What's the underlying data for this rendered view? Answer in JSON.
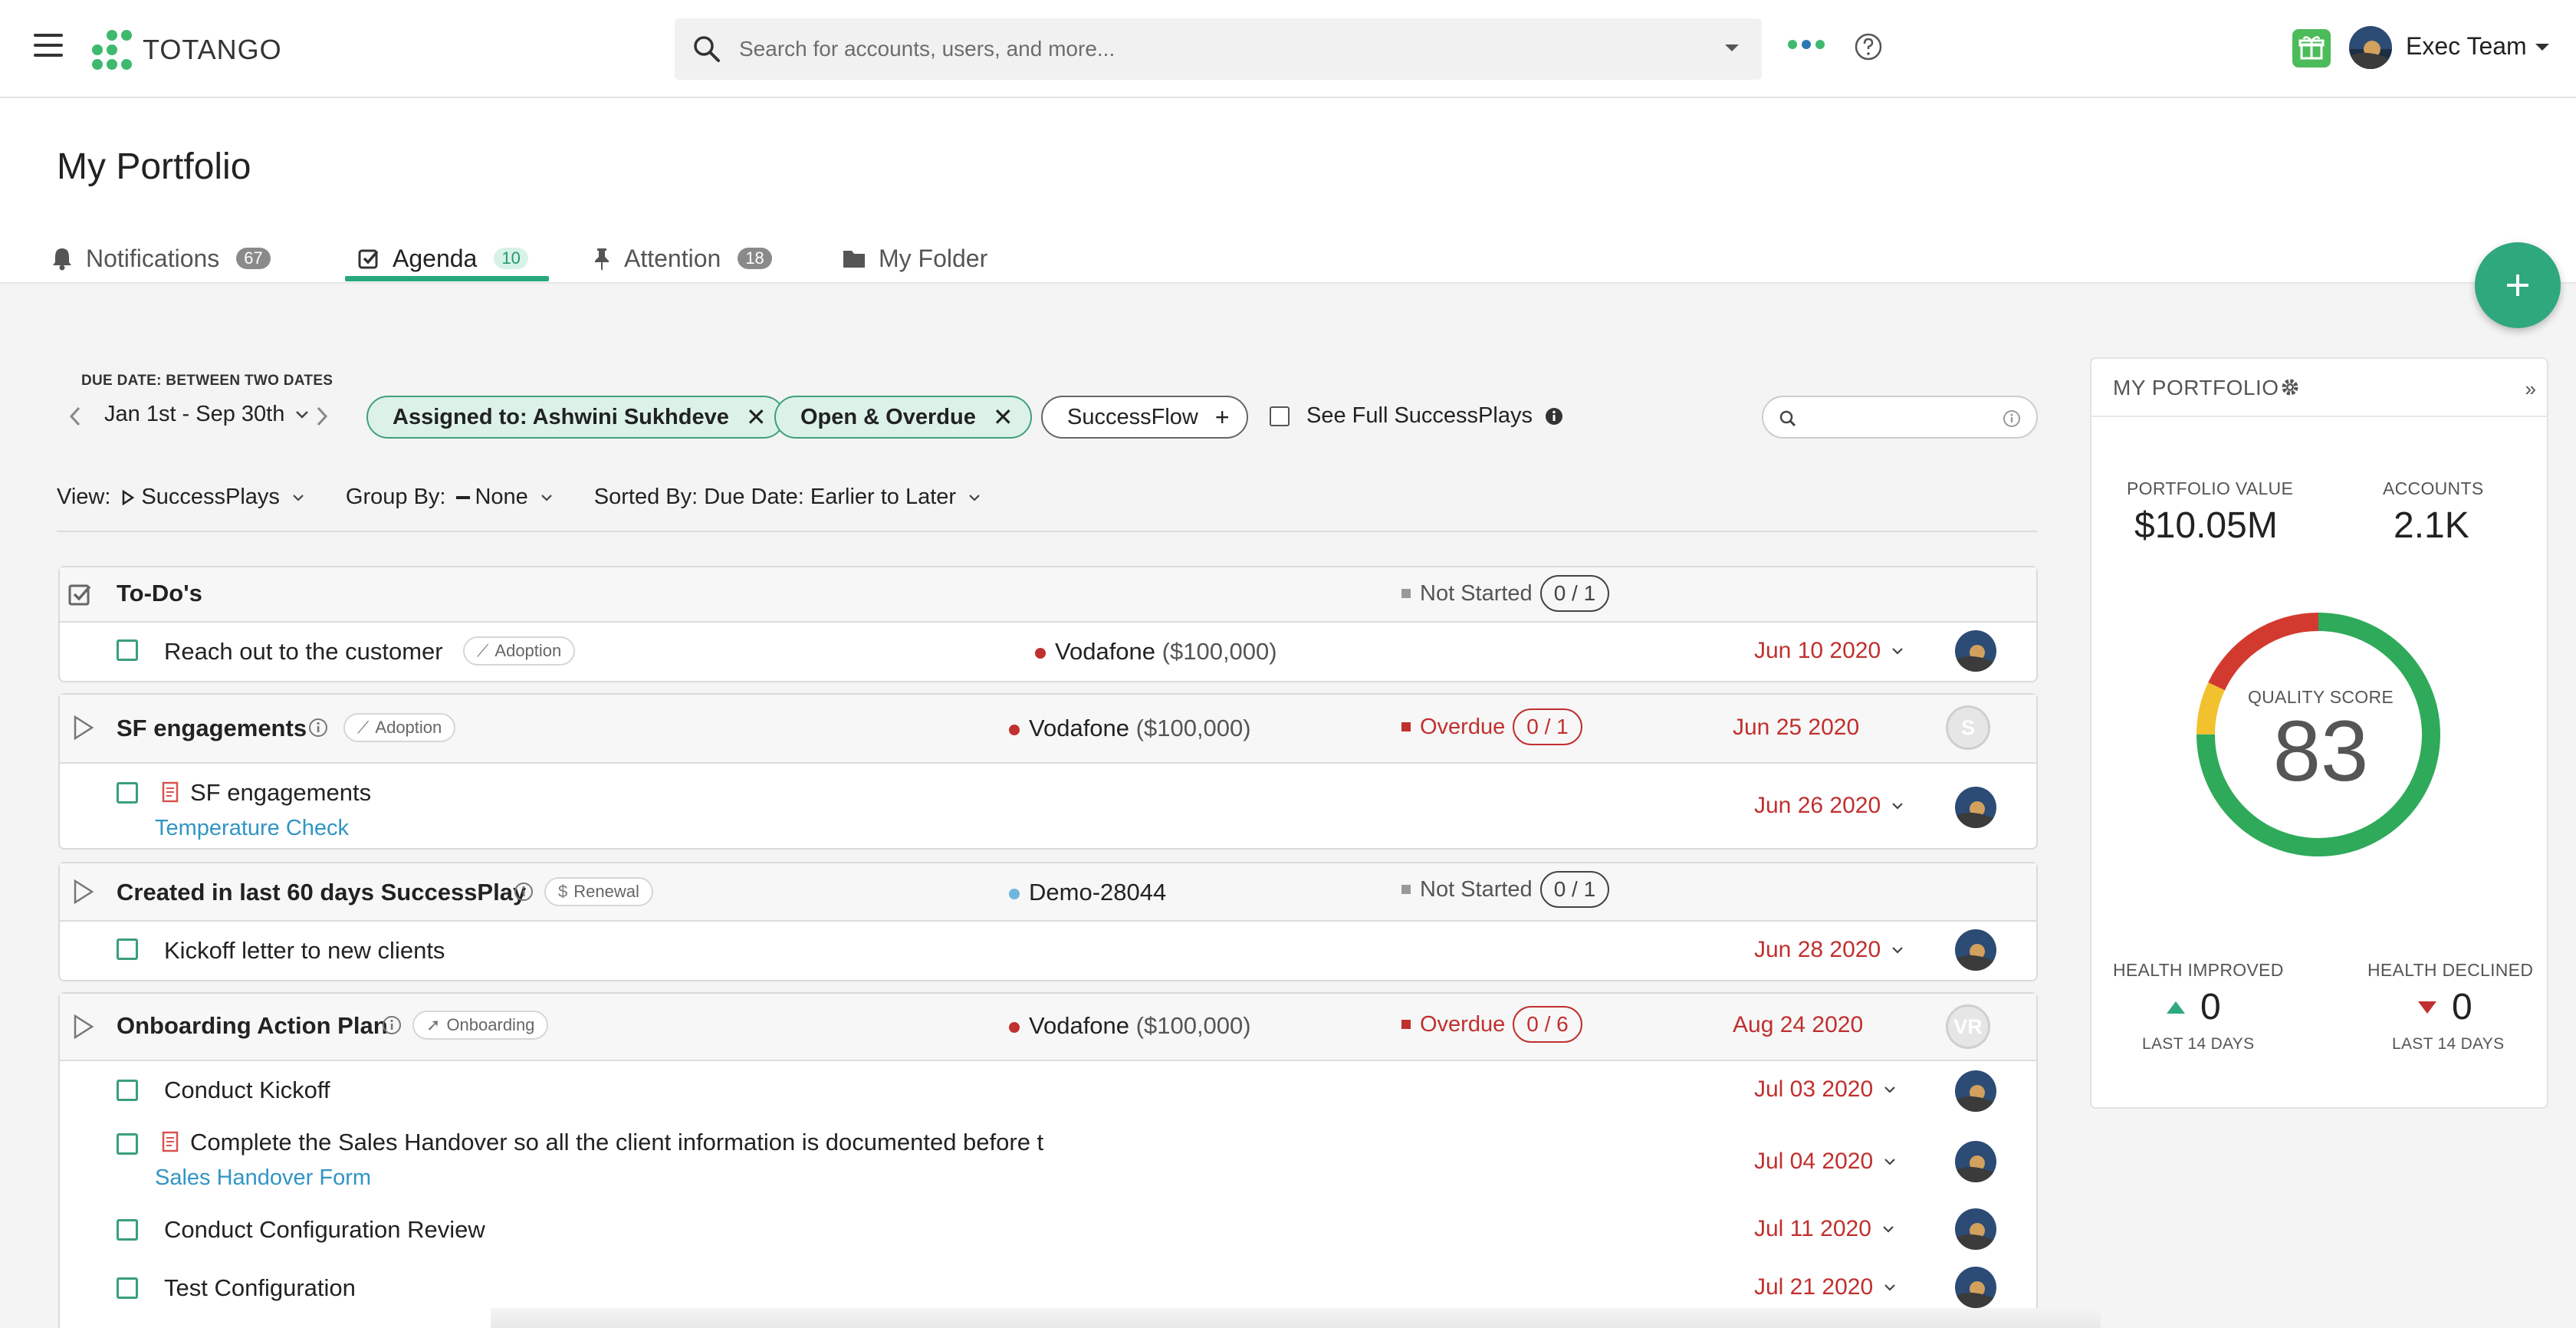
{
  "topbar": {
    "brand": "TOTANGO",
    "search_placeholder": "Search for accounts, users, and more...",
    "user_name": "Exec Team"
  },
  "page": {
    "title": "My Portfolio",
    "tabs": [
      {
        "label": "Notifications",
        "count": "67"
      },
      {
        "label": "Agenda",
        "count": "10",
        "active": true
      },
      {
        "label": "Attention",
        "count": "18"
      },
      {
        "label": "My Folder"
      }
    ]
  },
  "filters": {
    "due_label": "DUE DATE: BETWEEN TWO DATES",
    "date_range": "Jan 1st - Sep 30th",
    "chips": [
      "Assigned to: Ashwini Sukhdeve",
      "Open & Overdue"
    ],
    "successflow_chip": "SuccessFlow",
    "see_full": "See Full SuccessPlays",
    "view_label": "View:",
    "view_value": "SuccessPlays",
    "group_label": "Group By:",
    "group_value": "None",
    "sort_label": "Sorted By: Due Date: Earlier to Later"
  },
  "groups": [
    {
      "title": "To-Do's",
      "status": "Not Started",
      "progress": "0 / 1",
      "items": [
        {
          "title": "Reach out to the customer",
          "tag": "Adoption",
          "account": "Vodafone",
          "amount": "($100,000)",
          "due": "Jun 10 2020"
        }
      ]
    },
    {
      "title": "SF engagements",
      "tag": "Adoption",
      "account": "Vodafone",
      "amount": "($100,000)",
      "status": "Overdue",
      "progress": "0 / 1",
      "due": "Jun 25 2020",
      "owner_initials": "S",
      "items": [
        {
          "title": "SF engagements",
          "link": "Temperature Check",
          "due": "Jun 26 2020"
        }
      ]
    },
    {
      "title": "Created in last 60 days SuccessPlay",
      "tag": "Renewal",
      "tag_glyph": "$",
      "account": "Demo-28044",
      "status": "Not Started",
      "progress": "0 / 1",
      "items": [
        {
          "title": "Kickoff letter to new clients",
          "due": "Jun 28 2020"
        }
      ]
    },
    {
      "title": "Onboarding Action Plan",
      "tag": "Onboarding",
      "account": "Vodafone",
      "amount": "($100,000)",
      "status": "Overdue",
      "progress": "0 / 6",
      "due": "Aug 24 2020",
      "owner_initials": "VR",
      "items": [
        {
          "title": "Conduct Kickoff",
          "due": "Jul 03 2020"
        },
        {
          "title": "Complete the Sales Handover so all the client information is documented before t",
          "link": "Sales Handover Form",
          "due": "Jul 04 2020"
        },
        {
          "title": "Conduct Configuration Review",
          "due": "Jul 11 2020"
        },
        {
          "title": "Test Configuration",
          "due": "Jul 21 2020"
        }
      ]
    }
  ],
  "portfolio": {
    "title": "MY PORTFOLIO",
    "value_label": "PORTFOLIO VALUE",
    "value": "$10.05M",
    "accounts_label": "ACCOUNTS",
    "accounts": "2.1K",
    "quality_label": "QUALITY SCORE",
    "quality_score": "83",
    "quality_mix": {
      "good": 0.75,
      "warning": 0.07,
      "bad": 0.18
    },
    "improved_label": "HEALTH IMPROVED",
    "improved": "0",
    "declined_label": "HEALTH DECLINED",
    "declined": "0",
    "period": "LAST 14 DAYS"
  },
  "colors": {
    "brand_green": "#2fa87d",
    "overdue": "#c0302e",
    "link": "#3195c4"
  }
}
